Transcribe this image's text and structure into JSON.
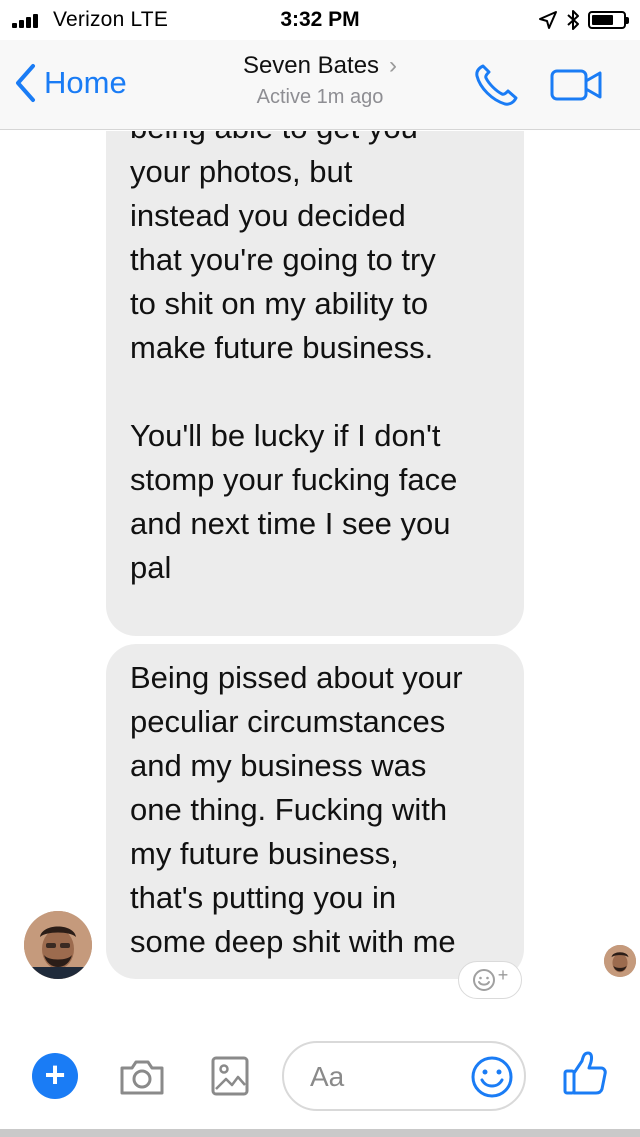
{
  "status_bar": {
    "carrier": "Verizon  LTE",
    "time": "3:32 PM",
    "battery_level": 0.7
  },
  "header": {
    "back_label": "Home",
    "contact_name": "Seven Bates",
    "contact_status": "Active 1m ago",
    "icons": [
      "chevron-left-icon",
      "phone-icon",
      "video-camera-icon"
    ]
  },
  "messages": [
    {
      "text": "being able to get you\nyour photos, but\ninstead you decided\nthat you're going to try\nto shit on my ability to\nmake future business.\n\nYou'll be lucky if I don't\nstomp your fucking face\nand next time I see you\npal"
    },
    {
      "text": "Being pissed about your\npeculiar circumstances\nand my business was\none thing. Fucking with\nmy future business,\nthat's putting you in\nsome deep shit with me"
    }
  ],
  "composer": {
    "placeholder": "Aa",
    "icons": [
      "plus-icon",
      "camera-icon",
      "photo-icon",
      "emoji-icon",
      "thumbs-up-icon"
    ]
  },
  "colors": {
    "accent": "#1a7cf5",
    "bubble": "#ececec",
    "header_bg": "#f8f8f8"
  }
}
